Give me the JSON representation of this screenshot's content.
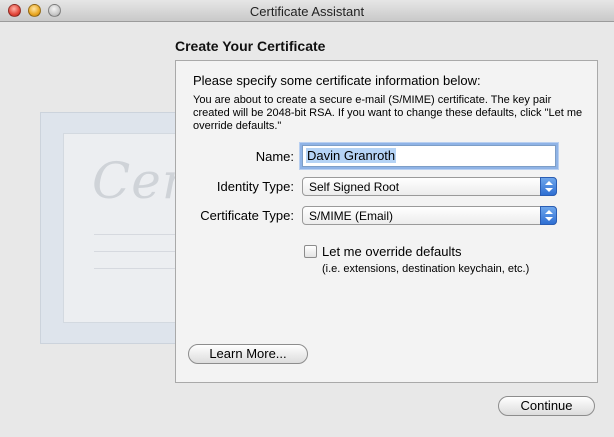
{
  "window": {
    "title": "Certificate Assistant"
  },
  "decoration": {
    "cert_script": "Certificate"
  },
  "header": {
    "title": "Create Your Certificate"
  },
  "content": {
    "intro_title": "Please specify some certificate information below:",
    "intro_text": "You are about to create a secure e-mail (S/MIME) certificate. The key pair created will be 2048-bit RSA. If you want to change these defaults, click \"Let me override defaults.\""
  },
  "form": {
    "name_label": "Name:",
    "name_value": "Davin Granroth",
    "identity_label": "Identity Type:",
    "identity_value": "Self Signed Root",
    "cert_type_label": "Certificate Type:",
    "cert_type_value": "S/MIME (Email)",
    "override_label": "Let me override defaults",
    "override_sub": "(i.e. extensions, destination keychain, etc.)",
    "override_checked": false
  },
  "buttons": {
    "learn_more": "Learn More...",
    "continue": "Continue"
  },
  "colors": {
    "accent_blue": "#2f6fd3",
    "focus_ring": "#8fb3e6",
    "selection": "#b5d3f5"
  }
}
